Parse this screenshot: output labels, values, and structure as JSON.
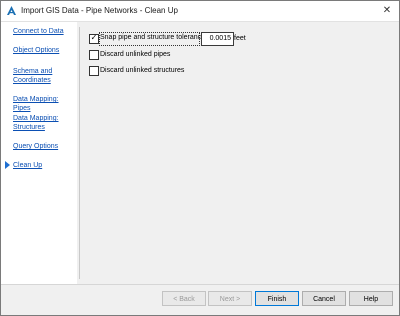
{
  "window": {
    "title": "Import GIS Data - Pipe Networks - Clean Up",
    "close_glyph": "✕",
    "icon": "autocad-civil-icon"
  },
  "sidebar": {
    "items": [
      {
        "label": "Connect to Data",
        "active": false
      },
      {
        "label": "Object Options",
        "active": false
      },
      {
        "label": "Schema and Coordinates",
        "active": false
      },
      {
        "label": "Data Mapping: Pipes",
        "active": false
      },
      {
        "label": "Data Mapping: Structures",
        "active": false
      },
      {
        "label": "Query Options",
        "active": false
      },
      {
        "label": "Clean Up",
        "active": true
      }
    ],
    "active_marker_icon": "triangle-right-icon",
    "accent_color": "#1f6fd1",
    "link_color": "#0b4fb3"
  },
  "cleanup": {
    "snap": {
      "label": "Snap pipe and structure tolerance:",
      "checked": true,
      "value": "0.0015",
      "unit": "feet"
    },
    "discard_pipes": {
      "label": "Discard unlinked pipes",
      "checked": false
    },
    "discard_structures": {
      "label": "Discard unlinked structures",
      "checked": false
    }
  },
  "buttons": {
    "back": {
      "label": "< Back",
      "disabled": true
    },
    "next": {
      "label": "Next >",
      "disabled": true
    },
    "finish": {
      "label": "Finish",
      "disabled": false
    },
    "cancel": {
      "label": "Cancel",
      "disabled": false
    },
    "help": {
      "label": "Help",
      "disabled": false
    }
  }
}
